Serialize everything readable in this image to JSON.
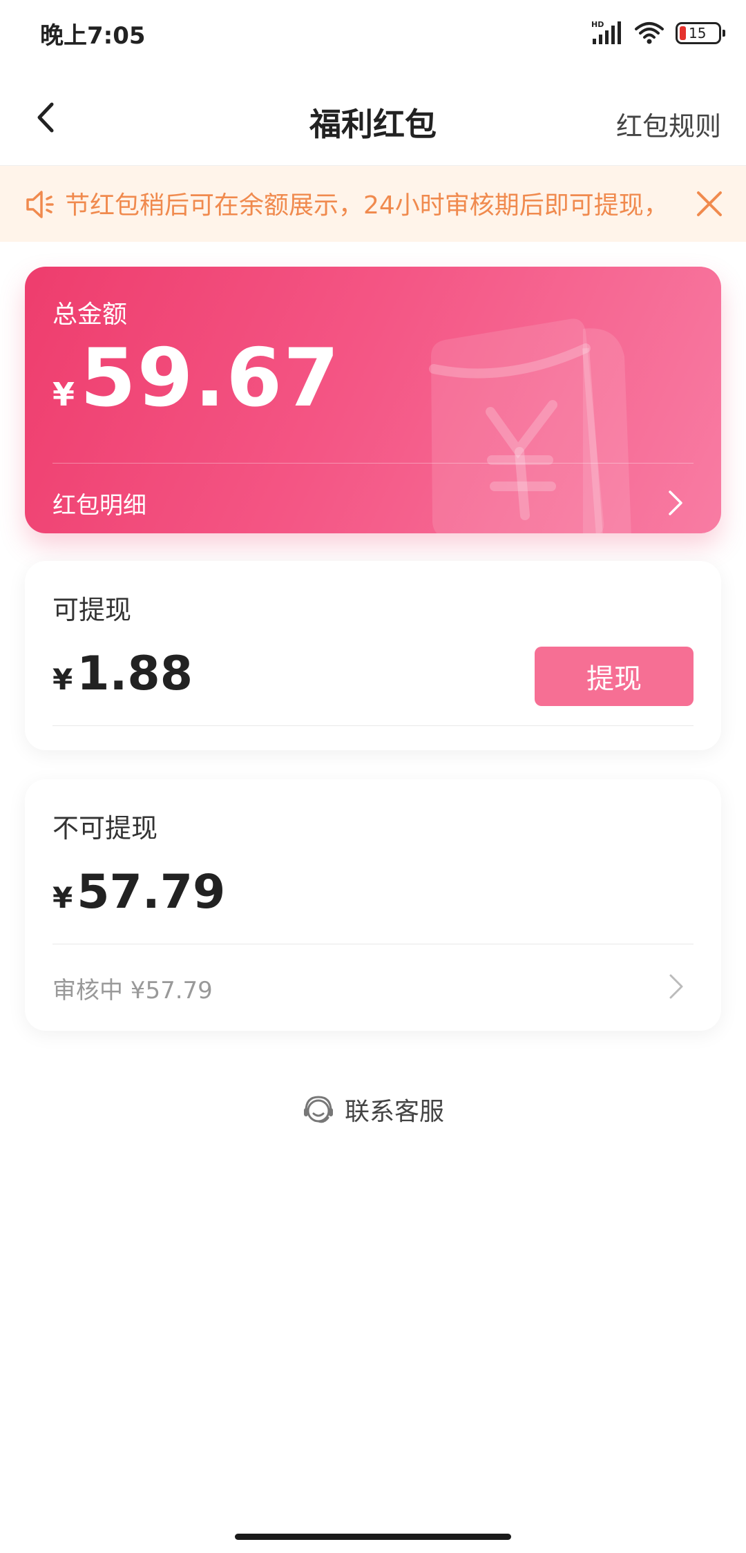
{
  "status_bar": {
    "time": "晚上7:05",
    "network_label": "HD",
    "battery_level": "15",
    "battery_color": "#e5322d"
  },
  "nav": {
    "back_icon": "chevron-left-icon",
    "title": "福利红包",
    "rules_link": "红包规则"
  },
  "notice": {
    "icon": "speaker-icon",
    "text": "节红包稍后可在余额展示，24小时审核期后即可提现，",
    "close_icon": "close-icon",
    "text_color": "#f08a4e",
    "background": "#fff4ea"
  },
  "total_card": {
    "label": "总金额",
    "currency": "¥",
    "amount": "59.67",
    "detail_link": "红包明细",
    "accent_color": "#ee3d6d"
  },
  "withdrawable": {
    "label": "可提现",
    "currency": "¥",
    "amount": "1.88",
    "button_label": "提现",
    "button_color": "#f66f94"
  },
  "non_withdrawable": {
    "label": "不可提现",
    "currency": "¥",
    "amount": "57.79",
    "review_text": "审核中 ¥57.79"
  },
  "service": {
    "icon": "headset-icon",
    "label": "联系客服"
  }
}
